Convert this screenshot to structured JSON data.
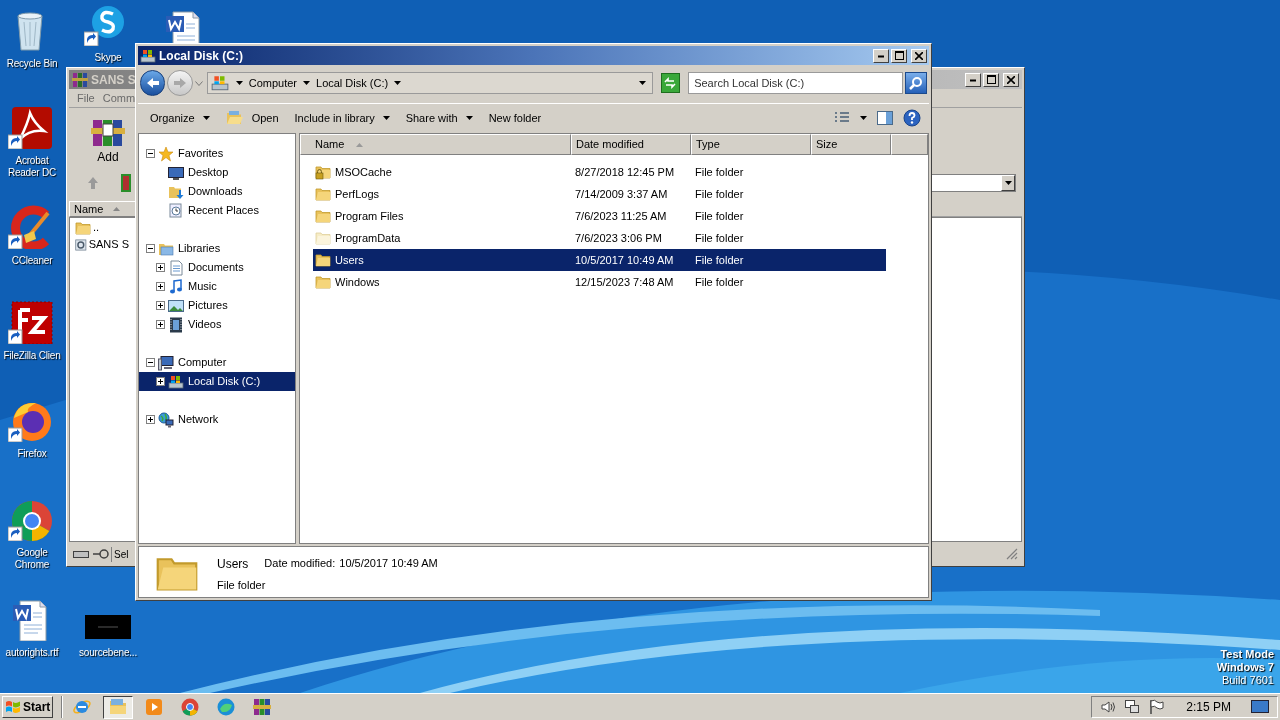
{
  "desktop_icons": [
    {
      "label": "Recycle Bin",
      "kind": "recycle-bin",
      "shortcut": false
    },
    {
      "label": "Skype",
      "kind": "skype",
      "shortcut": true
    },
    {
      "kind": "word",
      "shortcut": false
    },
    {
      "label": "Acrobat Reader DC",
      "kind": "pdf",
      "shortcut": true
    },
    {
      "label": "CCleaner",
      "kind": "ccleaner",
      "shortcut": true
    },
    {
      "label": "FileZilla Clien",
      "kind": "filezilla",
      "shortcut": true
    },
    {
      "label": "Firefox",
      "kind": "firefox",
      "shortcut": true
    },
    {
      "label": "Google Chrome",
      "kind": "chrome",
      "shortcut": true
    },
    {
      "label": "autorights.rtf",
      "kind": "word",
      "shortcut": false
    },
    {
      "label": "sourcebene...",
      "kind": "black-window",
      "shortcut": false
    }
  ],
  "background_window": {
    "title": "SANS S",
    "menu": [
      "File",
      "Comm"
    ],
    "toolbar_button": "Add",
    "column": "Name",
    "rows": [
      {
        "label": "..",
        "kind": "parent"
      },
      {
        "label": "SANS S",
        "kind": "file"
      }
    ],
    "status": "Sel"
  },
  "window": {
    "title": "Local Disk (C:)",
    "breadcrumb": [
      "Computer",
      "Local Disk (C:)"
    ],
    "search": {
      "placeholder": "Search Local Disk (C:)"
    },
    "toolbar": [
      {
        "label": "Organize",
        "kind": "menu"
      },
      {
        "label": "Open",
        "kind": "icon"
      },
      {
        "label": "Include in library",
        "kind": "menu"
      },
      {
        "label": "Share with",
        "kind": "menu"
      },
      {
        "label": "New folder",
        "kind": "plain"
      }
    ],
    "nav_tree": [
      {
        "label": "Favorites",
        "kind": "star",
        "expanded": true,
        "selected": false,
        "children": [
          {
            "label": "Desktop",
            "kind": "desktop",
            "selected": false
          },
          {
            "label": "Downloads",
            "kind": "downloads",
            "selected": false
          },
          {
            "label": "Recent Places",
            "kind": "recent",
            "selected": false
          }
        ]
      },
      {
        "label": "Libraries",
        "kind": "libraries",
        "expanded": true,
        "selected": false,
        "children": [
          {
            "label": "Documents",
            "kind": "documents",
            "expanded": false,
            "selected": false
          },
          {
            "label": "Music",
            "kind": "music",
            "expanded": false,
            "selected": false
          },
          {
            "label": "Pictures",
            "kind": "pictures",
            "expanded": false,
            "selected": false
          },
          {
            "label": "Videos",
            "kind": "videos",
            "expanded": false,
            "selected": false
          }
        ]
      },
      {
        "label": "Computer",
        "kind": "computer",
        "expanded": true,
        "selected": false,
        "children": [
          {
            "label": "Local Disk (C:)",
            "kind": "drive",
            "expanded": false,
            "selected": true
          }
        ]
      },
      {
        "label": "Network",
        "kind": "network",
        "expanded": false,
        "selected": false
      }
    ],
    "columns": [
      {
        "label": "Name",
        "sorted": true
      },
      {
        "label": "Date modified",
        "sorted": false
      },
      {
        "label": "Type",
        "sorted": false
      },
      {
        "label": "Size",
        "sorted": false
      }
    ],
    "files": [
      {
        "name": "MSOCache",
        "date": "8/27/2018 12:45 PM",
        "type": "File folder",
        "kind": "locked",
        "selected": false
      },
      {
        "name": "PerfLogs",
        "date": "7/14/2009 3:37 AM",
        "type": "File folder",
        "kind": "folder",
        "selected": false
      },
      {
        "name": "Program Files",
        "date": "7/6/2023 11:25 AM",
        "type": "File folder",
        "kind": "folder",
        "selected": false
      },
      {
        "name": "ProgramData",
        "date": "7/6/2023 3:06 PM",
        "type": "File folder",
        "kind": "hidden",
        "selected": false
      },
      {
        "name": "Users",
        "date": "10/5/2017 10:49 AM",
        "type": "File folder",
        "kind": "folder",
        "selected": true
      },
      {
        "name": "Windows",
        "date": "12/15/2023 7:48 AM",
        "type": "File folder",
        "kind": "folder",
        "selected": false
      }
    ],
    "details": {
      "name": "Users",
      "date_label": "Date modified:",
      "date": "10/5/2017 10:49 AM",
      "type": "File folder"
    }
  },
  "desktop_notice": [
    {
      "text": "Test Mode",
      "bold": true
    },
    {
      "text": "Windows 7",
      "bold": true
    },
    {
      "text": "Build 7601",
      "bold": false
    }
  ],
  "taskbar": {
    "start": "Start",
    "items": [
      {
        "kind": "ie",
        "selected": false
      },
      {
        "kind": "explorer",
        "selected": true
      },
      {
        "kind": "media",
        "selected": false
      },
      {
        "kind": "chrome",
        "selected": false
      },
      {
        "kind": "edge",
        "selected": false
      },
      {
        "kind": "winrar",
        "selected": false
      }
    ],
    "clock": "2:15 PM"
  }
}
